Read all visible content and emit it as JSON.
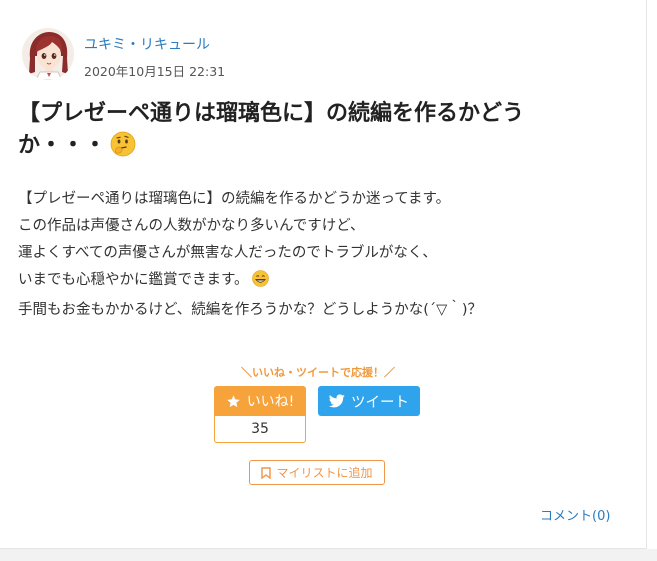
{
  "author": {
    "name": "ユキミ・リキュール",
    "avatar_icon": "anime-girl-avatar",
    "date": "2020年10月15日 22:31"
  },
  "post": {
    "title": "【プレゼーペ通りは瑠璃色に】の続編を作るかどうか・・・",
    "title_emoji": "thinking-face-icon",
    "body_lines": [
      "【プレゼーペ通りは瑠璃色に】の続編を作るかどうか迷ってます。",
      "この作品は声優さんの人数がかなり多いんですけど、",
      "運よくすべての声優さんが無害な人だったのでトラブルがなく、",
      "いまでも心穏やかに鑑賞できます。",
      "手間もお金もかかるけど、続編を作ろうかな？どうしようかな(´▽｀)？"
    ],
    "body_emoji": "grinning-face-icon"
  },
  "actions": {
    "cta": "＼いいね・ツイートで応援！／",
    "like_label": "いいね!",
    "like_count": "35",
    "tweet_label": "ツイート",
    "mylist_label": "マイリストに追加",
    "comment_label": "コメント(0)"
  },
  "colors": {
    "accent_orange": "#f6a33b",
    "twitter_blue": "#2fa3ec",
    "link_blue": "#2a7bbf"
  }
}
